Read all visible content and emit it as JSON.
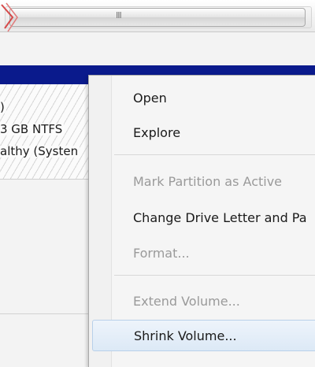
{
  "scrollbar": {
    "grip": "III"
  },
  "partition": {
    "line1": ")",
    "line2": "3 GB NTFS",
    "line3": "althy (Systen"
  },
  "context_menu": {
    "items": [
      {
        "label": "Open",
        "enabled": true
      },
      {
        "label": "Explore",
        "enabled": true
      },
      {
        "label": "Mark Partition as Active",
        "enabled": false
      },
      {
        "label": "Change Drive Letter and Pa",
        "enabled": true
      },
      {
        "label": "Format...",
        "enabled": false
      },
      {
        "label": "Extend Volume...",
        "enabled": false
      },
      {
        "label": "Shrink Volume...",
        "enabled": true,
        "highlighted": true
      }
    ]
  },
  "colors": {
    "disk_header": "#0a1a8c",
    "menu_highlight": "#dce9f6",
    "disabled_text": "#9a9a9a"
  }
}
